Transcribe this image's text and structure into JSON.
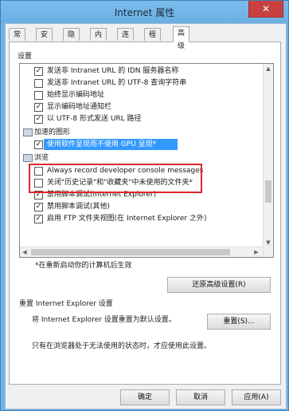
{
  "window": {
    "title": "Internet 属性",
    "close_label": "✕"
  },
  "tabs": [
    "常规",
    "安全",
    "隐私",
    "内容",
    "连接",
    "程序",
    "高级"
  ],
  "settings": {
    "group_label": "设置",
    "items": [
      {
        "type": "check",
        "checked": true,
        "label": "发送非 Intranet URL 的 IDN 服务器名称"
      },
      {
        "type": "check",
        "checked": false,
        "label": "发送非 Intranet URL 的 UTF-8 查询字符串"
      },
      {
        "type": "check",
        "checked": false,
        "label": "始终显示编码地址"
      },
      {
        "type": "check",
        "checked": true,
        "label": "显示编码地址通知栏"
      },
      {
        "type": "check",
        "checked": true,
        "label": "以 UTF-8 形式发送 URL 路径"
      },
      {
        "type": "category",
        "label": "加速的图形"
      },
      {
        "type": "check",
        "checked": true,
        "label": "使用软件呈现而不使用 GPU 呈现*",
        "selected": true
      },
      {
        "type": "category",
        "label": "浏览"
      },
      {
        "type": "check",
        "checked": false,
        "label": "Always record developer console messages"
      },
      {
        "type": "check",
        "checked": false,
        "label": "关闭\"历史记录\"和\"收藏夹\"中未使用的文件夹*"
      },
      {
        "type": "check",
        "checked": true,
        "label": "禁用脚本调试(Internet Explorer)"
      },
      {
        "type": "check",
        "checked": true,
        "label": "禁用脚本调试(其他)"
      },
      {
        "type": "check",
        "checked": true,
        "label": "启用 FTP 文件夹视图(在 Internet Explorer 之外)"
      }
    ],
    "restart_note": "*在重新启动你的计算机后生效",
    "restore_button": "还原高级设置(R)"
  },
  "reset": {
    "section_label": "重置 Internet Explorer 设置",
    "description": "将 Internet Explorer 设置重置为默认设置。",
    "reset_button": "重置(S)...",
    "only_note": "只有在浏览器处于无法使用的状态时，才应使用此设置。"
  },
  "footer": {
    "ok": "确定",
    "cancel": "取消",
    "apply": "应用(A)"
  },
  "colors": {
    "selection": "#3399ff",
    "highlight_box": "#e0262d",
    "title_bar": "#6fb3e6"
  }
}
